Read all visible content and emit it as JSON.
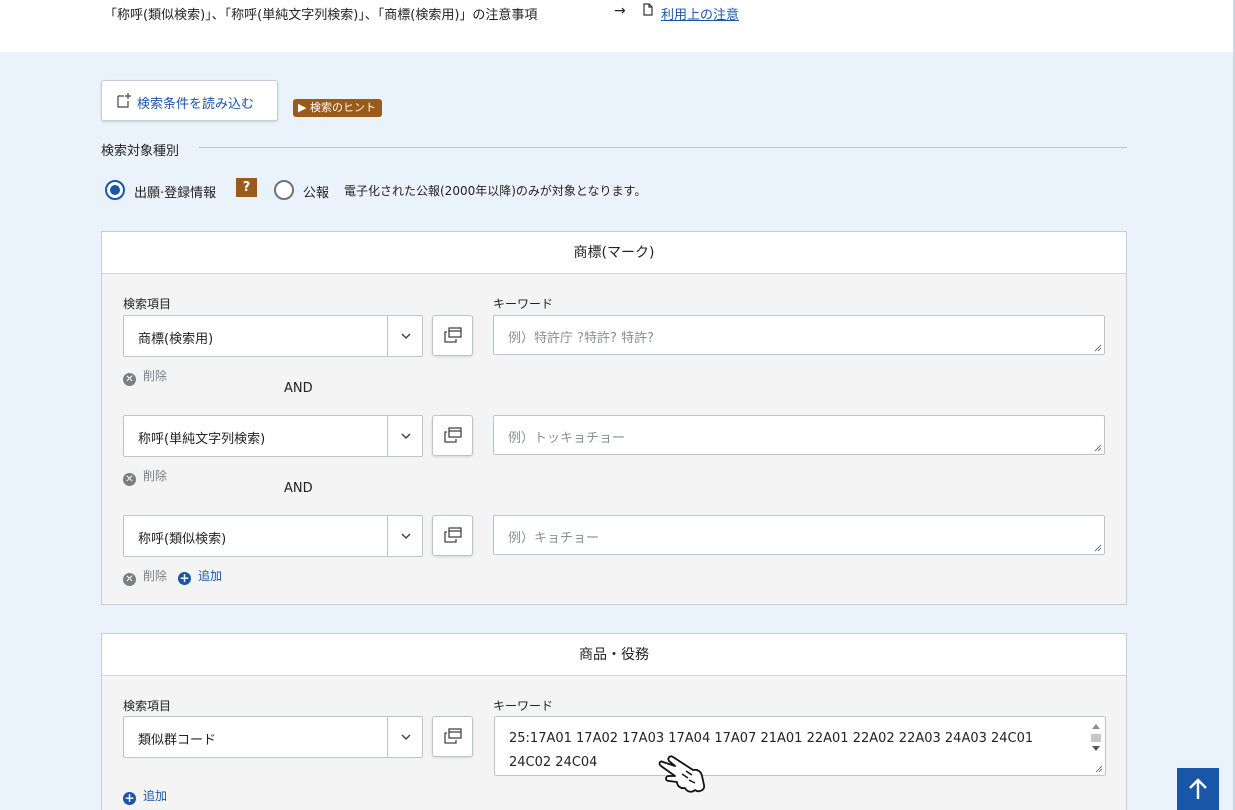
{
  "topbar": {
    "note": "「称呼(類似検索)」、「称呼(単純文字列検索)」、「商標(検索用)」の注意事項",
    "arrow": "→",
    "link": "利用上の注意"
  },
  "toolbar": {
    "load_conditions": "検索条件を読み込む",
    "hint": "▶ 検索のヒント"
  },
  "target": {
    "label": "検索対象種別",
    "options": [
      {
        "label": "出願·登録情報",
        "selected": true
      },
      {
        "label": "公報",
        "selected": false
      }
    ],
    "help": "?",
    "note": "電子化された公報(2000年以降)のみが対象となります。"
  },
  "mark_panel": {
    "title": "商標(マーク)",
    "field_label": "検索項目",
    "keyword_label": "キーワード",
    "rows": [
      {
        "field": "商標(検索用)",
        "placeholder": "例）特許庁 ?特許? 特許?"
      },
      {
        "field": "称呼(単純文字列検索)",
        "placeholder": "例）トッキョチョー"
      },
      {
        "field": "称呼(類似検索)",
        "placeholder": "例）キョチョー"
      }
    ],
    "and_label": "AND",
    "delete_label": "削除",
    "add_label": "追加"
  },
  "goods_panel": {
    "title": "商品・役務",
    "field_label": "検索項目",
    "keyword_label": "キーワード",
    "field": "類似群コード",
    "keyword_value": "25:17A01 17A02 17A03 17A04 17A07 21A01 22A01 22A02 22A03 24A03 24C01 24C02 24C04",
    "add_label": "追加"
  },
  "icons": {
    "back_to_top": "arrow-up-icon",
    "cursor": "pointer-hand-icon"
  },
  "colors": {
    "accent": "#1a56a8",
    "hint_badge": "#9a5a1a",
    "page_bg": "#eaf3fb"
  }
}
